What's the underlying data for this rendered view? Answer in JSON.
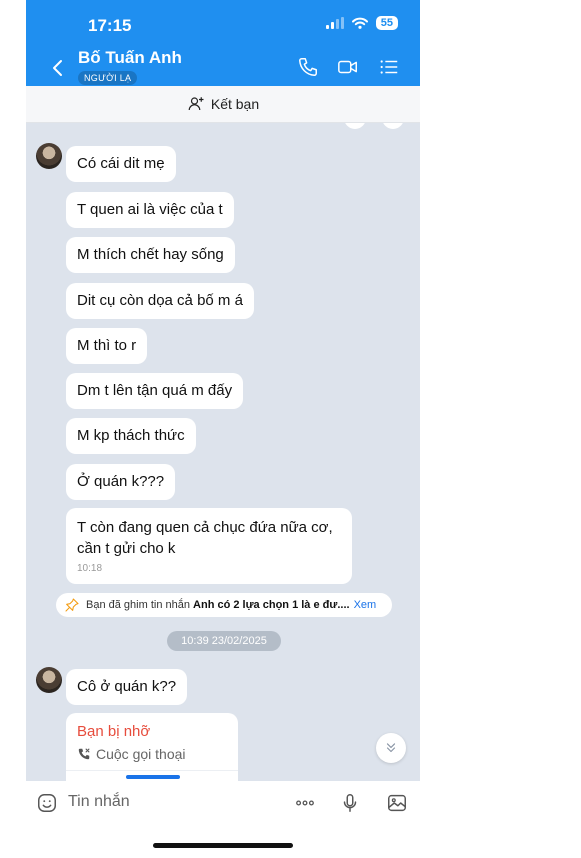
{
  "status_bar": {
    "time": "17:15",
    "battery": "55"
  },
  "header": {
    "contact_name": "Bố Tuấn Anh",
    "badge": "NGƯỜI LẠ",
    "colors": {
      "accent": "#1f8ff0"
    }
  },
  "add_friend": {
    "label": "Kết bạn"
  },
  "messages": [
    {
      "text": "Có cái dit mẹ"
    },
    {
      "text": "T quen ai là việc của t"
    },
    {
      "text": "M thích chết hay sống"
    },
    {
      "text": "Dit cụ còn dọa cả bố m á"
    },
    {
      "text": "M thì to r"
    },
    {
      "text": "Dm t lên tận quá m đấy"
    },
    {
      "text": "M kp thách thức"
    },
    {
      "text": "Ở quán k???"
    },
    {
      "text": "T còn đang quen cả chục đứa nữa cơ, cần t gửi cho k",
      "time": "10:18"
    }
  ],
  "pinned": {
    "prefix": "Bạn đã ghim tin nhắn",
    "message": "Anh có 2 lựa chọn 1 là e đư....",
    "action": "Xem"
  },
  "date_divider": "10:39 23/02/2025",
  "message_after": {
    "text": "Cô ở quán k??"
  },
  "missed_call": {
    "title": "Bạn bị nhỡ",
    "subtitle": "Cuộc gọi thoại"
  },
  "input": {
    "placeholder": "Tin nhắn"
  }
}
